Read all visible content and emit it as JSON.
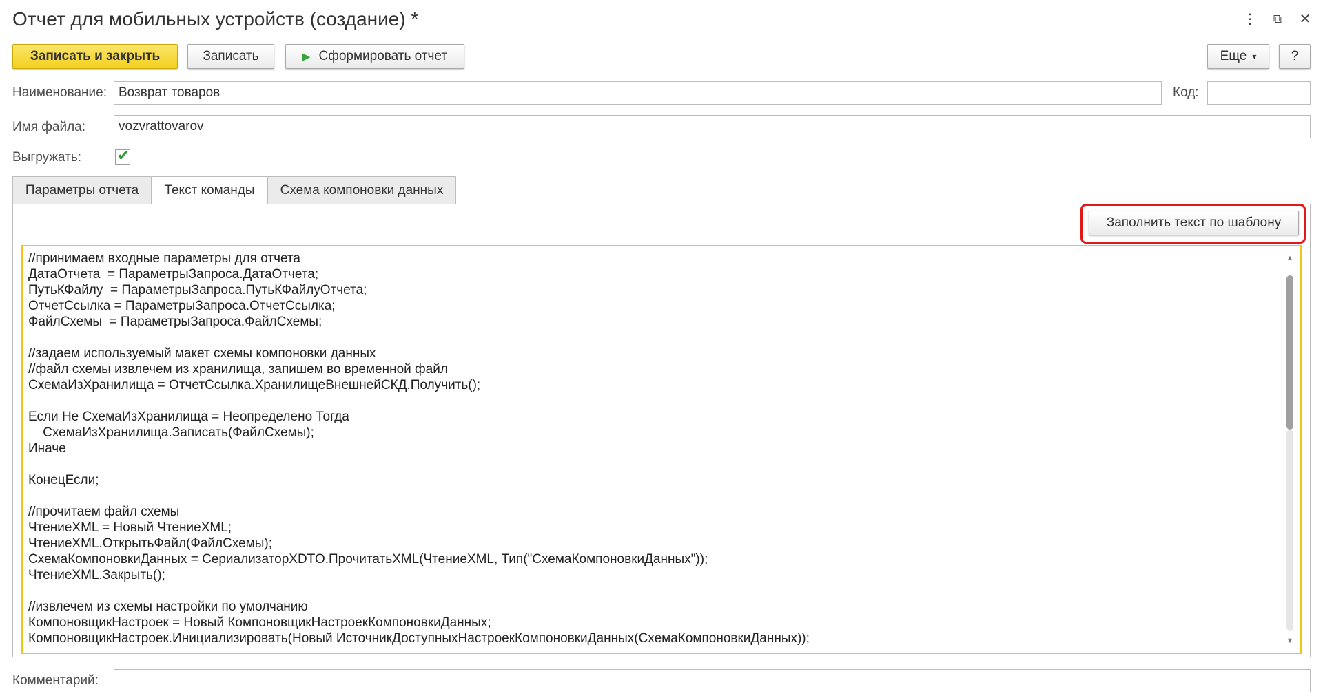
{
  "window": {
    "title": "Отчет для мобильных устройств (создание) *",
    "menu_glyph": "⋮",
    "restore_glyph": "⧉",
    "close_glyph": "✕"
  },
  "toolbar": {
    "save_close": "Записать и закрыть",
    "save": "Записать",
    "generate": "Сформировать отчет",
    "generate_icon": "▶",
    "more": "Еще",
    "more_icon": "▾",
    "help": "?"
  },
  "form": {
    "name_label": "Наименование:",
    "name_value": "Возврат товаров",
    "code_label": "Код:",
    "code_value": "",
    "filename_label": "Имя файла:",
    "filename_value": "vozvrattovarov",
    "export_label": "Выгружать:",
    "export_checked": true,
    "check_glyph": "✔",
    "comment_label": "Комментарий:",
    "comment_value": ""
  },
  "tabs": [
    {
      "label": "Параметры отчета",
      "active": false
    },
    {
      "label": "Текст команды",
      "active": true
    },
    {
      "label": "Схема компоновки данных",
      "active": false
    }
  ],
  "panel": {
    "fill_template_button": "Заполнить текст по шаблону"
  },
  "code_lines": [
    "//принимаем входные параметры для отчета",
    "ДатаОтчета  = ПараметрыЗапроса.ДатаОтчета;",
    "ПутьКФайлу  = ПараметрыЗапроса.ПутьКФайлуОтчета;",
    "ОтчетСсылка = ПараметрыЗапроса.ОтчетСсылка;",
    "ФайлСхемы  = ПараметрыЗапроса.ФайлСхемы;",
    "",
    "//задаем используемый макет схемы компоновки данных",
    "//файл схемы извлечем из хранилища, запишем во временной файл",
    "СхемаИзХранилища = ОтчетСсылка.ХранилищеВнешнейСКД.Получить();",
    "",
    "Если Не СхемаИзХранилища = Неопределено Тогда",
    "    СхемаИзХранилища.Записать(ФайлСхемы);",
    "Иначе",
    "",
    "КонецЕсли;",
    "",
    "//прочитаем файл схемы",
    "ЧтениеXML = Новый ЧтениеXML;",
    "ЧтениеXML.ОткрытьФайл(ФайлСхемы);",
    "СхемаКомпоновкиДанных = СериализаторXDTO.ПрочитатьXML(ЧтениеXML, Тип(\"СхемаКомпоновкиДанных\"));",
    "ЧтениеXML.Закрыть();",
    "",
    "//извлечем из схемы настройки по умолчанию",
    "КомпоновщикНастроек = Новый КомпоновщикНастроекКомпоновкиДанных;",
    "КомпоновщикНастроек.Инициализировать(Новый ИсточникДоступныхНастроекКомпоновкиДанных(СхемаКомпоновкиДанных));"
  ],
  "scrollbar": {
    "up_glyph": "▲",
    "down_glyph": "▼"
  }
}
